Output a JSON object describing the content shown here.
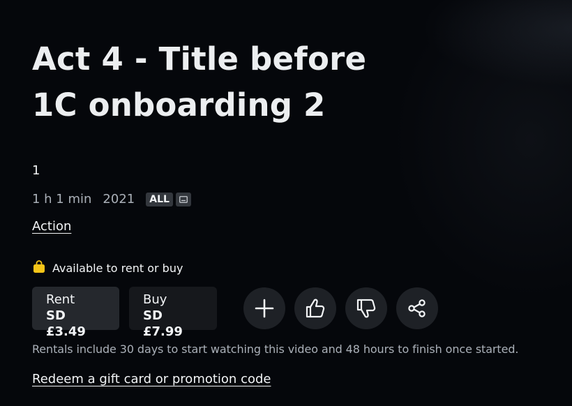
{
  "title": "Act 4 - Title before 1C onboarding 2",
  "season_number": "1",
  "meta": {
    "duration": "1 h 1 min",
    "year": "2021",
    "rating": "ALL"
  },
  "genre": "Action",
  "availability": "Available to rent or buy",
  "rent": {
    "label": "Rent",
    "price": "SD £3.49"
  },
  "buy": {
    "label": "Buy",
    "price": "SD £7.99"
  },
  "icons": {
    "add": "plus-icon",
    "like": "thumbs-up-icon",
    "dislike": "thumbs-down-icon",
    "share": "share-icon",
    "availability": "shopping-bag-icon",
    "subtitles": "subtitles-icon"
  },
  "disclaimer": "Rentals include 30 days to start watching this video and 48 hours to finish once started.",
  "redeem_link": "Redeem a gift card or promotion code",
  "colors": {
    "background": "#05070b",
    "accent_bag": "#f5c518",
    "rent_button": "#25282d",
    "buy_button": "#16181c"
  }
}
